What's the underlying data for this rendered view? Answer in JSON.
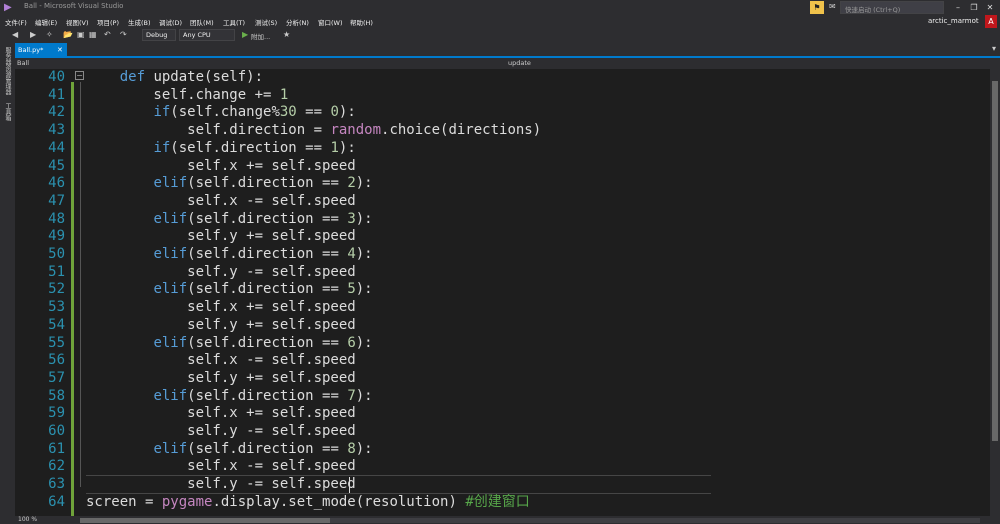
{
  "window": {
    "title": "Ball - Microsoft Visual Studio",
    "quick_launch_placeholder": "快速启动 (Ctrl+Q)",
    "user_name": "arctic_marmot",
    "user_initial": "A"
  },
  "menu": [
    "文件(F)",
    "编辑(E)",
    "视图(V)",
    "项目(P)",
    "生成(B)",
    "调试(D)",
    "团队(M)",
    "工具(T)",
    "测试(S)",
    "分析(N)",
    "窗口(W)",
    "帮助(H)"
  ],
  "toolbar": {
    "config": "Debug",
    "platform": "Any CPU",
    "run_label": "附加..."
  },
  "side_tabs": [
    "服务器资源管理器",
    "工具箱"
  ],
  "tabs": [
    {
      "label": "Ball.py*",
      "active": true
    }
  ],
  "navbar": {
    "left": "Ball",
    "right": "update"
  },
  "editor": {
    "lines": [
      {
        "n": "40",
        "html": "    <span class='k'>def</span> update(self):"
      },
      {
        "n": "41",
        "html": "        self.change += <span class='n'>1</span>"
      },
      {
        "n": "42",
        "html": "        <span class='k'>if</span>(self.change%<span class='n'>30</span> == <span class='n'>0</span>):"
      },
      {
        "n": "43",
        "html": "            self.direction = <span class='b'>random</span>.choice(directions)"
      },
      {
        "n": "44",
        "html": "        <span class='k'>if</span>(self.direction == <span class='n'>1</span>):"
      },
      {
        "n": "45",
        "html": "            self.x += self.speed"
      },
      {
        "n": "46",
        "html": "        <span class='k'>elif</span>(self.direction == <span class='n'>2</span>):"
      },
      {
        "n": "47",
        "html": "            self.x -= self.speed"
      },
      {
        "n": "48",
        "html": "        <span class='k'>elif</span>(self.direction == <span class='n'>3</span>):"
      },
      {
        "n": "49",
        "html": "            self.y += self.speed"
      },
      {
        "n": "50",
        "html": "        <span class='k'>elif</span>(self.direction == <span class='n'>4</span>):"
      },
      {
        "n": "51",
        "html": "            self.y -= self.speed"
      },
      {
        "n": "52",
        "html": "        <span class='k'>elif</span>(self.direction == <span class='n'>5</span>):"
      },
      {
        "n": "53",
        "html": "            self.x += self.speed"
      },
      {
        "n": "54",
        "html": "            self.y += self.speed"
      },
      {
        "n": "55",
        "html": "        <span class='k'>elif</span>(self.direction == <span class='n'>6</span>):"
      },
      {
        "n": "56",
        "html": "            self.x -= self.speed"
      },
      {
        "n": "57",
        "html": "            self.y += self.speed"
      },
      {
        "n": "58",
        "html": "        <span class='k'>elif</span>(self.direction == <span class='n'>7</span>):"
      },
      {
        "n": "59",
        "html": "            self.x += self.speed"
      },
      {
        "n": "60",
        "html": "            self.y -= self.speed"
      },
      {
        "n": "61",
        "html": "        <span class='k'>elif</span>(self.direction == <span class='n'>8</span>):"
      },
      {
        "n": "62",
        "html": "            self.x -= self.speed"
      },
      {
        "n": "63",
        "html": "            self.y -= self.speed"
      },
      {
        "n": "64",
        "html": "screen = <span class='b'>pygame</span>.display.set_mode(resolution) <span class='c'>#创建窗口</span>"
      }
    ]
  },
  "status": {
    "zoom": "100 %"
  },
  "colors": {
    "accent": "#007acc",
    "editor_bg": "#1e1e1e",
    "chrome_bg": "#2d2d30",
    "keyword": "#569cd6",
    "number": "#b5cea8",
    "line_number": "#2b91af"
  }
}
